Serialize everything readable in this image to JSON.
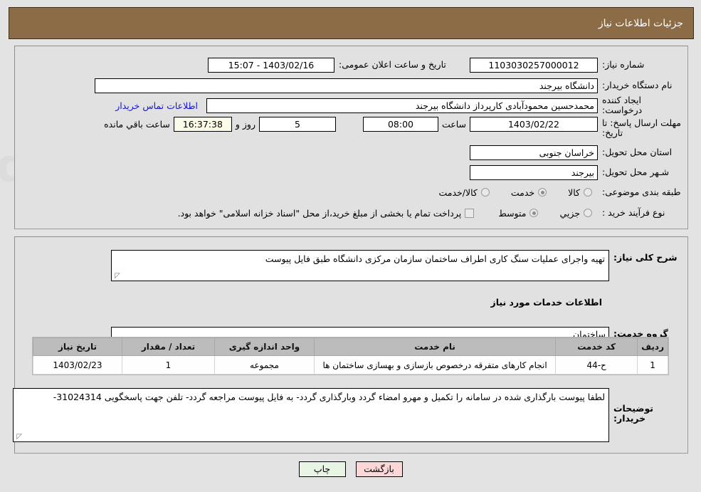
{
  "header": {
    "title": "جزئیات اطلاعات نیاز"
  },
  "form": {
    "need_number_label": "شماره نیاز:",
    "need_number_value": "1103030257000012",
    "announce_datetime_label": "تاریخ و ساعت اعلان عمومی:",
    "announce_datetime_value": "1403/02/16 - 15:07",
    "buyer_org_label": "نام دستگاه خریدار:",
    "buyer_org_value": "دانشگاه بیرجند",
    "creator_label": "ایجاد کننده درخواست:",
    "creator_value": "محمدحسین محمودآبادی کارپرداز دانشگاه بیرجند",
    "contact_link": "اطلاعات تماس خریدار",
    "deadline_label": "مهلت ارسال پاسخ: تا تاریخ:",
    "deadline_date": "1403/02/22",
    "deadline_hour_label": "ساعت",
    "deadline_hour_value": "08:00",
    "remaining_days": "5",
    "remaining_days_suffix": "روز و",
    "remaining_time": "16:37:38",
    "remaining_time_suffix": "ساعت باقي مانده",
    "province_label": "استان محل تحویل:",
    "province_value": "خراسان جنوبی",
    "city_label": "شـهر محل تحویل:",
    "city_value": "بیرجند",
    "category_label": "طبقه بندی موضوعی:",
    "category_options": [
      {
        "label": "کالا",
        "checked": false
      },
      {
        "label": "خدمت",
        "checked": true
      },
      {
        "label": "کالا/خدمت",
        "checked": false
      }
    ],
    "process_label": "نوع فرآیند خرید :",
    "process_options": [
      {
        "label": "جزیي",
        "checked": false
      },
      {
        "label": "متوسط",
        "checked": true
      }
    ],
    "treasury_checkbox_checked": false,
    "treasury_text": "پرداخت تمام یا بخشی از مبلغ خرید،از محل \"اسناد خزانه اسلامی\" خواهد بود."
  },
  "details": {
    "general_desc_label": "شرح کلی نیاز:",
    "general_desc_value": "تهیه واجرای عملیات سنگ کاری اطراف ساختمان سازمان مرکزی دانشگاه طبق فایل پیوست",
    "services_section_title": "اطلاعات خدمات مورد نیاز",
    "service_group_label": "گروه خدمت:",
    "service_group_value": "ساختمان",
    "buyer_notes_label": "توضیحات خریدار:",
    "buyer_notes_value": "لطفا پیوست بارگذاری شده در سامانه را تکمیل و مهرو امضاء گردد وبارگذاری گردد- به فایل پیوست مراجعه گردد- تلفن جهت پاسخگویی 31024314-"
  },
  "table": {
    "headers": [
      "ردیف",
      "کد خدمت",
      "نام خدمت",
      "واحد اندازه گیری",
      "تعداد / مقدار",
      "تاریخ نیاز"
    ],
    "rows": [
      {
        "row_no": "1",
        "service_code": "ح-44",
        "service_name": "انجام کارهای متفرقه درخصوص بازسازی و بهسازی ساختمان ها",
        "unit": "مجموعه",
        "quantity": "1",
        "need_date": "1403/02/23"
      }
    ]
  },
  "buttons": {
    "print": "چاپ",
    "back": "بازگشت"
  },
  "colors": {
    "header_bg": "#8b6c47",
    "page_bg": "#e3e3e3",
    "panel_bg": "#e1e1e1",
    "link": "#1414d2",
    "table_header_bg": "#bcbcbc",
    "print_btn_bg": "#e8f5e4",
    "back_btn_bg": "#fbd7d7",
    "timer_bg": "#fbfbe8"
  }
}
